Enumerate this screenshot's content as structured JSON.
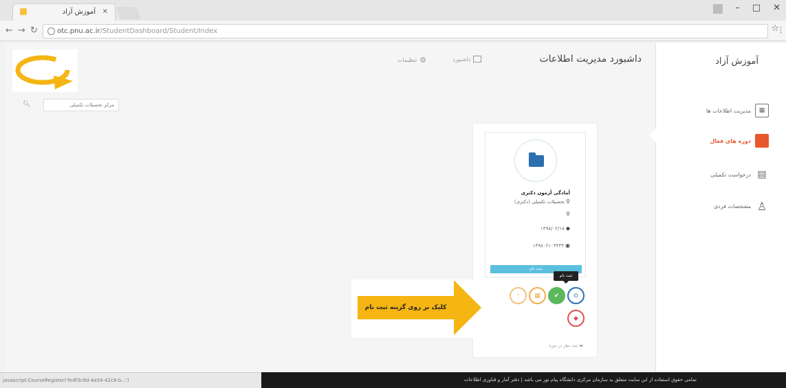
{
  "browser": {
    "tab_title": "آموزش آزاد",
    "tab_close": "×",
    "url_host": "otc.pnu.ac.ir",
    "url_path": "/StudentDashboard/Student/Index",
    "window_controls": [
      "–",
      "□",
      "✕"
    ],
    "star": "☆",
    "menu": "⋮"
  },
  "sidebar": {
    "brand": "آموزش آزاد",
    "items": [
      {
        "label": "مدیریت اطلاعات ها",
        "icon": "table-icon",
        "active": false
      },
      {
        "label": "دوره های فعال",
        "icon": "grid-icon",
        "active": true
      },
      {
        "label": "درخواست تکمیلی",
        "icon": "document-icon",
        "active": false
      },
      {
        "label": "مشخصات فردی",
        "icon": "user-icon",
        "active": false
      }
    ]
  },
  "header": {
    "title": "داشبورد مدیریت اطلاعات",
    "link1": "داشبورد",
    "link2": "تنظیمات"
  },
  "search": {
    "placeholder": "مرکز تحصیلات تکمیلی"
  },
  "card": {
    "course_name": "آمادگی آزمون دکتری",
    "location": "تحصیلات تکمیلی (دکتری)",
    "row2": "",
    "date": "۱۳۹۸/۰۲/۱۸",
    "code": "۱۳۹۸۰۲۱۰۴۴۳۳",
    "register_bar": "ثبت نام",
    "tooltip": "ثبت نام",
    "footer": "ثبت نظر در دوره"
  },
  "callout": {
    "text": "کلیک بر روی گزینه ثبت نام"
  },
  "status": {
    "url": "javascript:CourseRegister('fe4f3c9d-4a54-42c9-b...')",
    "footer_text": "تمامی حقوق استفاده از این سایت متعلق به سازمان مرکزی دانشگاه پیام نور می باشد | دفتر آمار و فناوری اطلاعات"
  },
  "colors": {
    "accent": "#e8582c",
    "callout": "#f5b512",
    "register": "#5cb85c"
  }
}
